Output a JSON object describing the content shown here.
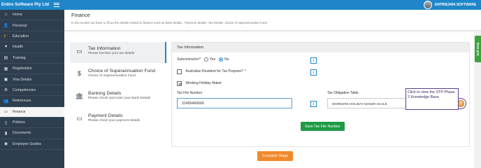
{
  "topbar": {
    "brand": "Entire Software Pty Ltd",
    "username": "ENTIRE2404 SOFTWARE"
  },
  "sidebar": {
    "items": [
      {
        "label": "Home",
        "icon": "home-icon",
        "glyph": "⌂"
      },
      {
        "label": "Personal",
        "icon": "user-icon",
        "glyph": "👤"
      },
      {
        "label": "Education",
        "icon": "graduation-cap-icon",
        "glyph": "🎓"
      },
      {
        "label": "Health",
        "icon": "heart-icon",
        "glyph": "♥"
      },
      {
        "label": "Training",
        "icon": "book-icon",
        "glyph": "▤"
      },
      {
        "label": "Registration",
        "icon": "clipboard-icon",
        "glyph": "▦"
      },
      {
        "label": "Visa Details",
        "icon": "passport-icon",
        "glyph": "▣"
      },
      {
        "label": "Competencies",
        "icon": "gear-icon",
        "glyph": "⚙"
      },
      {
        "label": "References",
        "icon": "people-icon",
        "glyph": "👥"
      },
      {
        "label": "Finance",
        "icon": "money-icon",
        "glyph": "▭"
      },
      {
        "label": "Policies",
        "icon": "document-icon",
        "glyph": "▯"
      },
      {
        "label": "Documents",
        "icon": "folder-icon",
        "glyph": "▮"
      },
      {
        "label": "Employee Guides",
        "icon": "globe-icon",
        "glyph": "◉"
      }
    ],
    "active_index": 9
  },
  "header": {
    "title": "Finance",
    "subtitle": "In this section we have to fill up the details related to finance such as Bank details , Payment details ,Tax Details ,choice of superannuation Fund"
  },
  "steps": [
    {
      "title": "Tax Information",
      "desc": "Please Declare your tax details",
      "icon": "money-icon",
      "glyph": "▭"
    },
    {
      "title": "Choice of Superannuation Fund",
      "desc": "Choice of Superannuation Fund",
      "icon": "dollar-icon",
      "glyph": "$"
    },
    {
      "title": "Banking Details",
      "desc": "Please check and enter your Bank Details",
      "icon": "bank-icon",
      "glyph": "🏛"
    },
    {
      "title": "Payment Details",
      "desc": "Please check your payment details",
      "icon": "credit-card-icon",
      "glyph": "▭"
    }
  ],
  "form": {
    "heading": "Tax Information",
    "subcontractor_label": "Subcontractor?",
    "yes_label": "Yes",
    "no_label": "No",
    "subcontractor_value": "No",
    "resident_label": "Australian Resident for Tax Purpose?",
    "resident_required": "*",
    "resident_checked": false,
    "whm_label": "Working Holiday Maker",
    "whm_checked": true,
    "tfn_label": "Tax File Number",
    "tfn_value": "31456466666",
    "obligation_label": "Tax Obligation Table",
    "obligation_value": "WORKERS HOLIDAY MAKER SCALE",
    "save_button": "Save Tax File Number"
  },
  "callout": "Click to view the STP Phase 2 Knowledge Base",
  "complete_button": "Complete Stage",
  "self_help": "Self Help",
  "info_glyph": "i",
  "help_glyph": "?"
}
